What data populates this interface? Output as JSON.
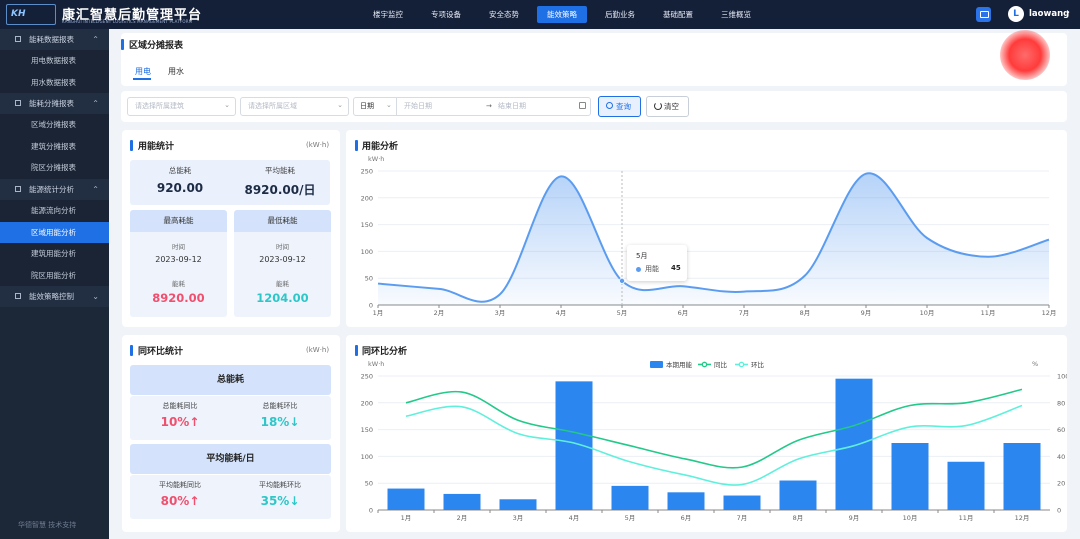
{
  "header": {
    "logo_text": "KH",
    "title": "康汇智慧后勤管理平台",
    "subtitle": "KANGHUI INTELLIGENT LOGISTICS MANAGEMENT PLATFORM",
    "nav": [
      "楼宇监控",
      "专项设备",
      "安全态势",
      "能效策略",
      "后勤业务",
      "基础配置",
      "三维概览"
    ],
    "nav_active": "能效策略",
    "avatar_letter": "L",
    "username": "laowang"
  },
  "sidebar": {
    "groups": [
      {
        "label": "能耗数据报表",
        "expanded": true,
        "items": [
          "用电数据报表",
          "用水数据报表"
        ]
      },
      {
        "label": "能耗分摊报表",
        "expanded": true,
        "items": [
          "区域分摊报表",
          "建筑分摊报表",
          "院区分摊报表"
        ]
      },
      {
        "label": "能源统计分析",
        "expanded": true,
        "items": [
          "能源流向分析",
          "区域用能分析",
          "建筑用能分析",
          "院区用能分析"
        ]
      },
      {
        "label": "能效策略控制",
        "expanded": false,
        "items": []
      }
    ],
    "active_item": "区域用能分析",
    "footer": "华德智慧 技术支持"
  },
  "page": {
    "title": "区域分摊报表",
    "tabs": [
      "用电",
      "用水"
    ],
    "active_tab": "用电"
  },
  "filters": {
    "building_placeholder": "请选择所属建筑",
    "area_placeholder": "请选择所属区域",
    "date_type": "日期",
    "start_placeholder": "开始日期",
    "end_placeholder": "结束日期",
    "query_button": "查询",
    "clear_button": "清空"
  },
  "usage_stats": {
    "title": "用能统计",
    "unit": "(kW·h)",
    "total_label": "总能耗",
    "total_value": "920.00",
    "avg_label": "平均能耗",
    "avg_value": "8920.00/日",
    "max": {
      "header": "最高耗能",
      "time_label": "时间",
      "date": "2023-09-12",
      "value_label": "能耗",
      "value": "8920.00"
    },
    "min": {
      "header": "最低耗能",
      "time_label": "时间",
      "date": "2023-09-12",
      "value_label": "能耗",
      "value": "1204.00"
    }
  },
  "yoy_stats": {
    "title": "同环比统计",
    "unit": "(kW·h)",
    "total_header": "总能耗",
    "total_yoy_label": "总能耗同比",
    "total_yoy_value": "10%↑",
    "total_mom_label": "总能耗环比",
    "total_mom_value": "18%↓",
    "avg_header": "平均能耗/日",
    "avg_yoy_label": "平均能耗同比",
    "avg_yoy_value": "80%↑",
    "avg_mom_label": "平均能耗环比",
    "avg_mom_value": "35%↓"
  },
  "colors": {
    "accent": "#1f6fe5",
    "up": "#f0506e",
    "down": "#2fc6c8"
  },
  "chart_data": [
    {
      "type": "area",
      "title": "用能分析",
      "ylabel": "kW·h",
      "categories": [
        "1月",
        "2月",
        "3月",
        "4月",
        "5月",
        "6月",
        "7月",
        "8月",
        "9月",
        "10月",
        "11月",
        "12月"
      ],
      "series": [
        {
          "name": "用能",
          "values": [
            40,
            30,
            20,
            240,
            45,
            35,
            25,
            55,
            245,
            125,
            90,
            122
          ]
        }
      ],
      "ylim": [
        0,
        250
      ],
      "yticks": [
        0,
        50,
        100,
        150,
        200,
        250
      ],
      "grid": true,
      "tooltip": {
        "category": "5月",
        "series": "用能",
        "value": 45
      }
    },
    {
      "type": "bar",
      "title": "同环比分析",
      "ylabel": "kW·h",
      "y2label": "%",
      "categories": [
        "1月",
        "2月",
        "3月",
        "4月",
        "5月",
        "6月",
        "7月",
        "8月",
        "9月",
        "10月",
        "11月",
        "12月"
      ],
      "series": [
        {
          "name": "本期用能",
          "type": "bar",
          "axis": "left",
          "values": [
            40,
            30,
            20,
            240,
            45,
            33,
            27,
            55,
            245,
            125,
            90,
            125
          ]
        },
        {
          "name": "同比",
          "type": "line",
          "axis": "right",
          "values": [
            80,
            88,
            67,
            58,
            48,
            38,
            32,
            52,
            63,
            78,
            80,
            90
          ]
        },
        {
          "name": "环比",
          "type": "line",
          "axis": "right",
          "values": [
            70,
            77,
            57,
            50,
            36,
            26,
            19,
            38,
            48,
            62,
            63,
            78
          ]
        }
      ],
      "ylim": [
        0,
        250
      ],
      "yticks": [
        0,
        50,
        100,
        150,
        200,
        250
      ],
      "y2lim": [
        0,
        100
      ],
      "y2ticks": [
        0,
        20,
        40,
        60,
        80,
        100
      ],
      "legend": "top-center",
      "grid": true
    }
  ]
}
